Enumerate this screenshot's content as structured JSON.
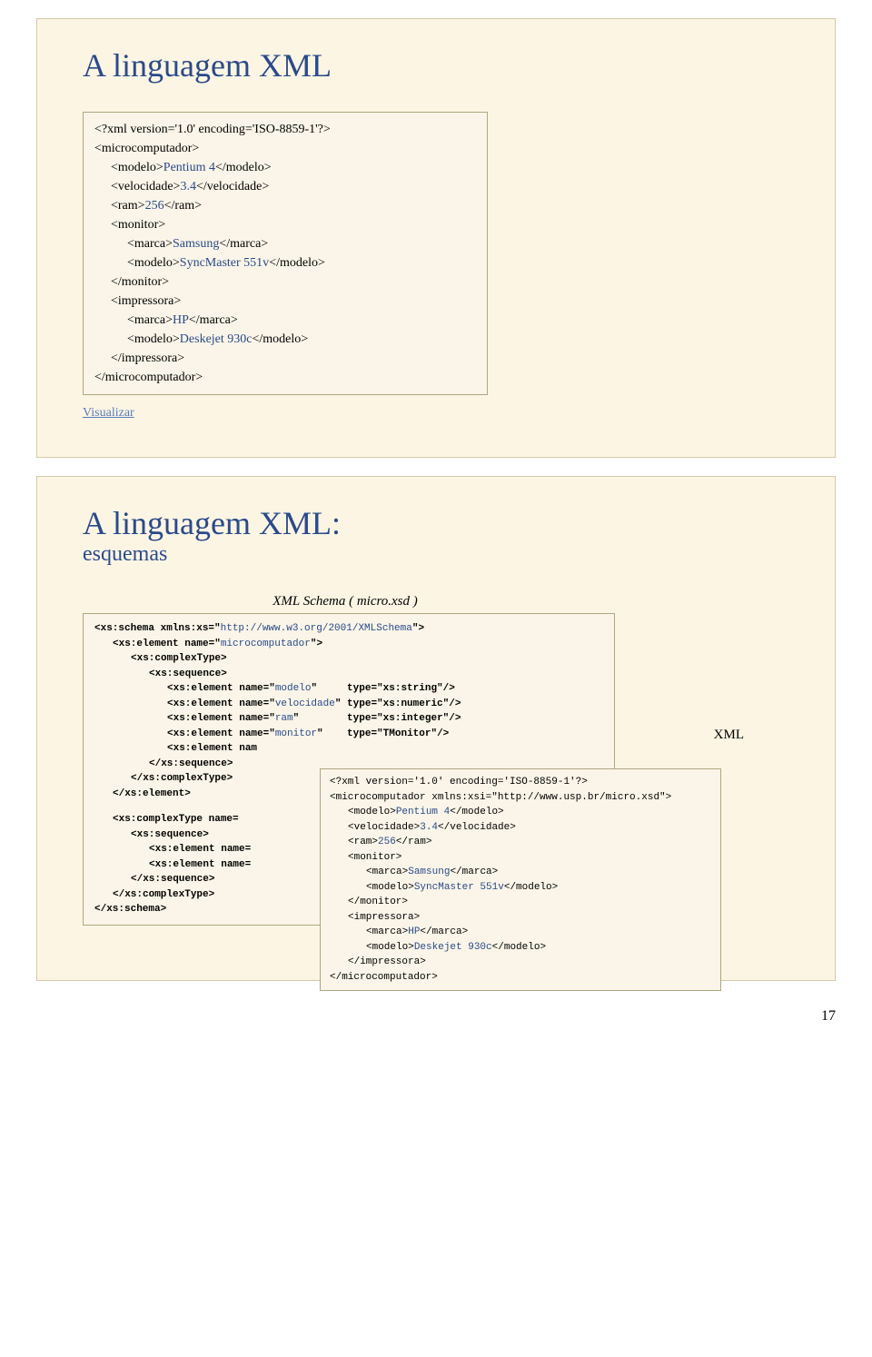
{
  "slide1": {
    "title": "A linguagem XML",
    "xml": {
      "decl": "<?xml version='1.0' encoding='ISO-8859-1'?>",
      "root_open": "<microcomputador>",
      "modelo": {
        "open": "<modelo>",
        "val": "Pentium 4",
        "close": "</modelo>"
      },
      "velocidade": {
        "open": "<velocidade>",
        "val": "3.4",
        "close": "</velocidade>"
      },
      "ram": {
        "open": "<ram>",
        "val": "256",
        "close": "</ram>"
      },
      "monitor_open": "<monitor>",
      "mon_marca": {
        "open": "<marca>",
        "val": "Samsung",
        "close": "</marca>"
      },
      "mon_modelo": {
        "open": "<modelo>",
        "val": "SyncMaster 551v",
        "close": "</modelo>"
      },
      "monitor_close": "</monitor>",
      "impressora_open": "<impressora>",
      "imp_marca": {
        "open": "<marca>",
        "val": "HP",
        "close": "</marca>"
      },
      "imp_modelo": {
        "open": "<modelo>",
        "val": "Deskejet 930c",
        "close": "</modelo>"
      },
      "impressora_close": "</impressora>",
      "root_close": "</microcomputador>"
    },
    "link": "Visualizar"
  },
  "slide2": {
    "title": "A linguagem XML:",
    "subtitle": "esquemas",
    "schema_title": "XML Schema ( micro.xsd )",
    "xml_label": "XML",
    "s": {
      "l1a": "<xs:schema xmlns:xs=\"",
      "l1b": "http://www.w3.org/2001/XMLSchema",
      "l1c": "\">",
      "l2a": "<xs:element name=\"",
      "l2b": "microcomputador",
      "l2c": "\">",
      "l3": "<xs:complexType>",
      "l4": "<xs:sequence>",
      "l5a": "<xs:element name=\"",
      "l5b": "modelo",
      "l5c": "\"     type=\"xs:string\"/>",
      "l6a": "<xs:element name=\"",
      "l6b": "velocidade",
      "l6c": "\" type=\"xs:numeric\"/>",
      "l7a": "<xs:element name=\"",
      "l7b": "ram",
      "l7c": "\"        type=\"xs:integer\"/>",
      "l8a": "<xs:element name=\"",
      "l8b": "monitor",
      "l8c": "\"    type=\"TMonitor\"/>",
      "l9": "<xs:element nam",
      "l10": "</xs:sequence>",
      "l11": "</xs:complexType>",
      "l12": "</xs:element>",
      "l13": "<xs:complexType name=",
      "l14": "<xs:sequence>",
      "l15": "<xs:element name=",
      "l16": "<xs:element name=",
      "l17": "</xs:sequence>",
      "l18": "</xs:complexType>",
      "l19": "</xs:schema>"
    },
    "ov": {
      "decl": "<?xml version='1.0' encoding='ISO-8859-1'?>",
      "root": "<microcomputador xmlns:xsi=\"http://www.usp.br/micro.xsd\">",
      "modelo": {
        "o": "<modelo>",
        "v": "Pentium 4",
        "c": "</modelo>"
      },
      "vel": {
        "o": "<velocidade>",
        "v": "3.4",
        "c": "</velocidade>"
      },
      "ram": {
        "o": "<ram>",
        "v": "256",
        "c": "</ram>"
      },
      "mon_o": "<monitor>",
      "mon_marca": {
        "o": "<marca>",
        "v": "Samsung",
        "c": "</marca>"
      },
      "mon_modelo": {
        "o": "<modelo>",
        "v": "SyncMaster 551v",
        "c": "</modelo>"
      },
      "mon_c": "</monitor>",
      "imp_o": "<impressora>",
      "imp_marca": {
        "o": "<marca>",
        "v": "HP",
        "c": "</marca>"
      },
      "imp_modelo": {
        "o": "<modelo>",
        "v": "Deskejet 930c",
        "c": "</modelo>"
      },
      "imp_c": "</impressora>",
      "root_c": "</microcomputador>"
    }
  },
  "page_num": "17"
}
